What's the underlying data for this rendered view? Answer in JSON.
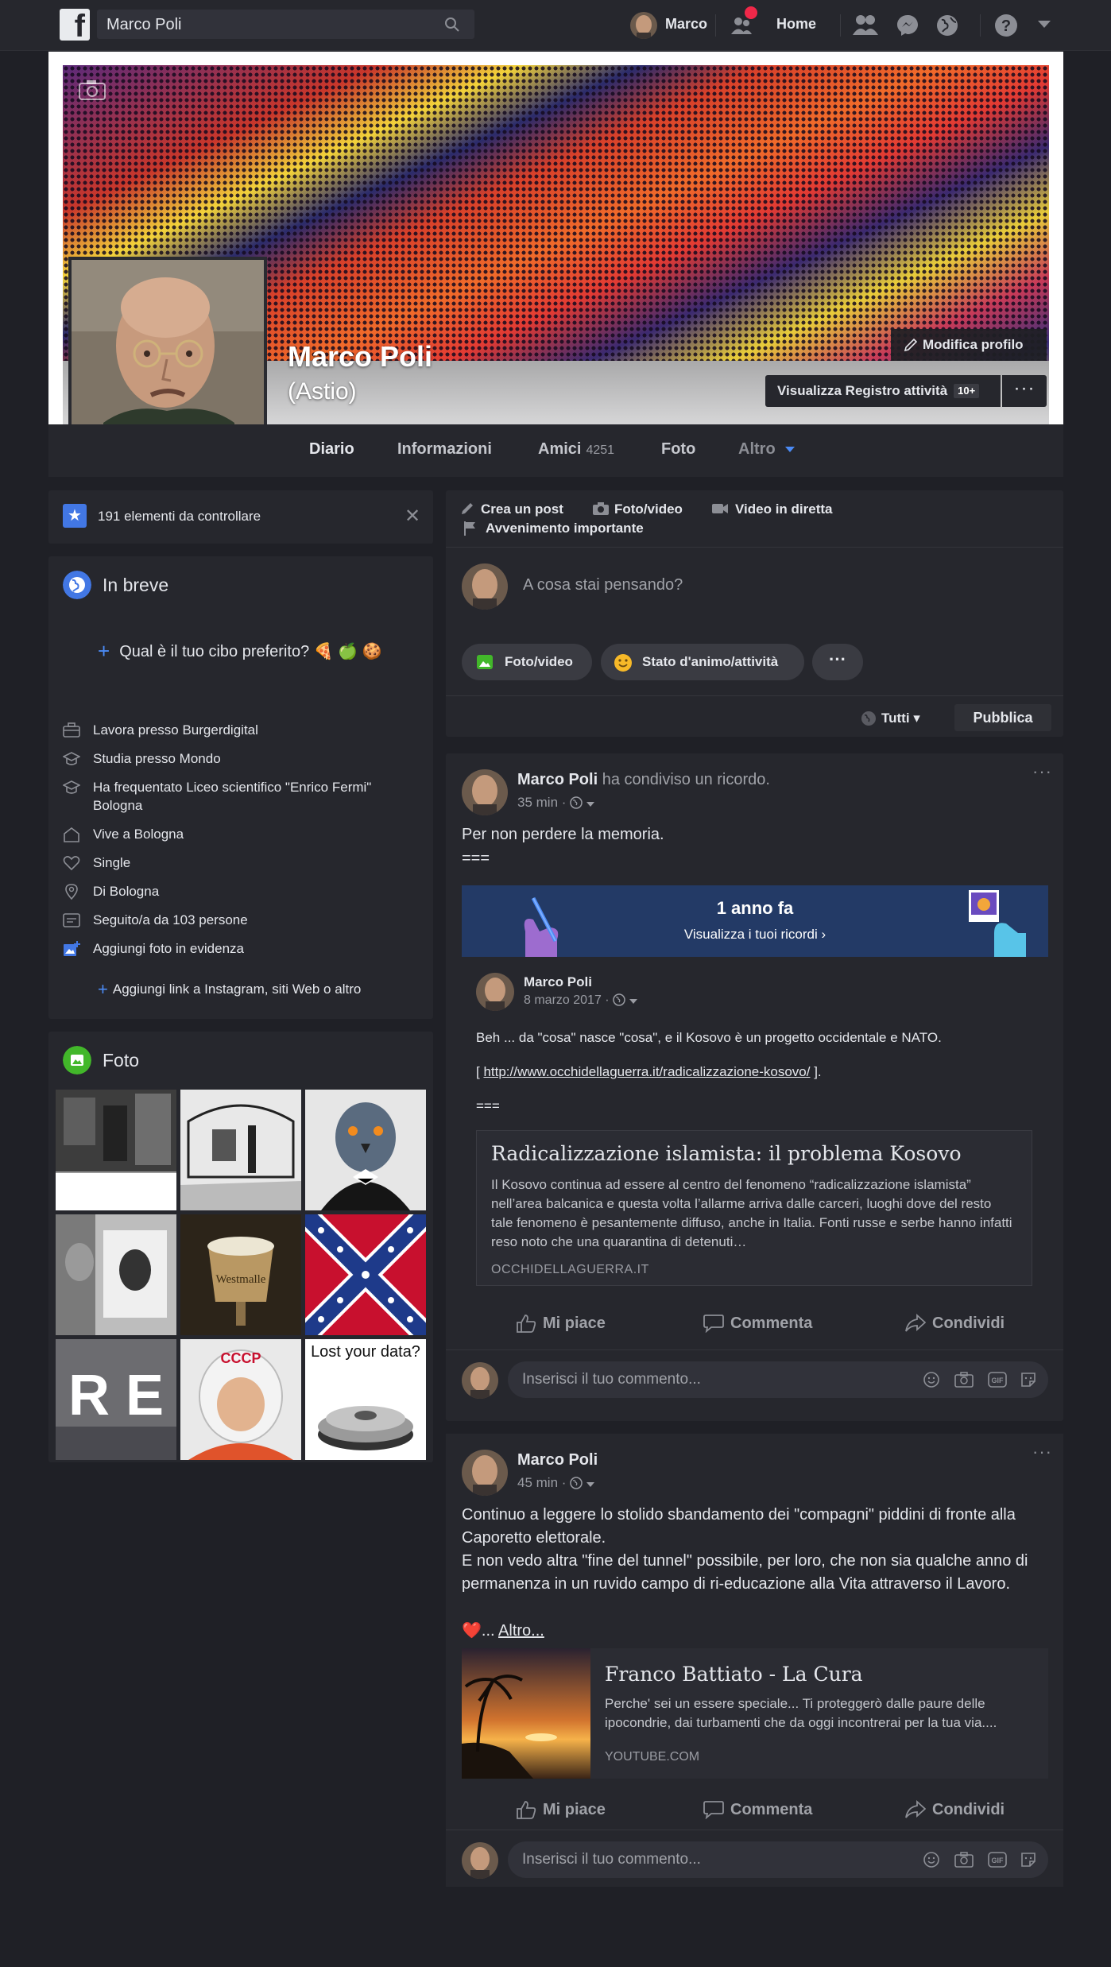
{
  "topbar": {
    "logo": "f",
    "search_value": "Marco Poli",
    "user_name": "Marco",
    "home_label": "Home"
  },
  "profile": {
    "name": "Marco Poli",
    "alt_name": "(Astio)",
    "edit_label": "Modifica profilo",
    "activity_log_label": "Visualizza Registro attività",
    "activity_badge": "10+",
    "more_label": "···"
  },
  "tabs": [
    {
      "label": "Diario"
    },
    {
      "label": "Informazioni"
    },
    {
      "label": "Amici",
      "count": "4251"
    },
    {
      "label": "Foto"
    },
    {
      "label": "Altro"
    }
  ],
  "review": {
    "text": "191 elementi da controllare",
    "close": "✕"
  },
  "intro": {
    "title": "In breve",
    "fav_food": "Qual è il tuo cibo preferito? 🍕 🍏 🍪",
    "items": [
      "Lavora presso Burgerdigital",
      "Studia presso Mondo",
      "Ha frequentato Liceo scientifico \"Enrico Fermi\" Bologna",
      "Vive a Bologna",
      "Single",
      "Di Bologna",
      "Seguito/a da 103 persone",
      "Aggiungi foto in evidenza"
    ],
    "add_link": "Aggiungi link a Instagram, siti Web o altro"
  },
  "photos": {
    "title": "Foto",
    "tile_text": [
      "R E",
      "Lost your data?",
      "CCCP",
      "Westmalle"
    ]
  },
  "composer": {
    "options": [
      "Crea un post",
      "Foto/video",
      "Video in diretta",
      "Avvenimento importante"
    ],
    "placeholder": "A cosa stai pensando?",
    "pills": [
      "Foto/video",
      "Stato d'animo/attività",
      "···"
    ],
    "audience": "Tutti",
    "publish": "Pubblica"
  },
  "post1": {
    "author": "Marco Poli",
    "action": "ha condiviso un ricordo.",
    "time": "35 min ·",
    "text_line1": "Per non perdere la memoria.",
    "text_line2": "===",
    "memory_title": "1 anno fa",
    "memory_sub": "Visualizza i tuoi ricordi ›",
    "inner_author": "Marco Poli",
    "inner_time": "8 marzo 2017 ·",
    "inner_text1": "Beh ... da \"cosa\" nasce \"cosa\", e il Kosovo è un progetto occidentale e NATO.",
    "inner_link_pre": "[ ",
    "inner_link": "http://www.occhidellaguerra.it/radicalizzazione-kosovo/",
    "inner_link_post": " ].",
    "inner_text3": "===",
    "card_title": "Radicalizzazione islamista: il problema Kosovo",
    "card_desc": "Il Kosovo continua ad essere al centro del fenomeno “radicalizzazione islamista” nell’area balcanica e questa volta l’allarme arriva dalle carceri, luoghi dove del resto tale fenomeno è pesantemente diffuso, anche in Italia. Fonti russe e serbe hanno infatti reso noto che una quarantina di detenuti…",
    "card_source": "OCCHIDELLAGUERRA.IT"
  },
  "post2": {
    "author": "Marco Poli",
    "time": "45 min ·",
    "text": "Continuo a leggere lo stolido sbandamento dei \"compagni\" piddini di fronte alla Caporetto elettorale.",
    "text2": "E non vedo altra \"fine del tunnel\" possibile, per loro, che non sia qualche anno di permanenza in un ruvido campo di ri-educazione alla Vita attraverso il Lavoro.",
    "heart": "❤️",
    "more_pre": "... ",
    "more": "Altro...",
    "card_title": "Franco Battiato - La Cura",
    "card_desc": "Perche' sei un essere speciale... Ti proteggerò dalle paure delle ipocondrie, dai turbamenti che da oggi incontrerai per la tua via....",
    "card_source": "YOUTUBE.COM"
  },
  "actions": {
    "like": "Mi piace",
    "comment": "Commenta",
    "share": "Condividi"
  },
  "comment": {
    "placeholder": "Inserisci il tuo commento...",
    "gif": "GIF"
  },
  "colors": {
    "background": "#1f2026",
    "card": "#26272d",
    "accent": "#4b8bf5",
    "memory_banner": "#233a66",
    "notification": "#f02849"
  }
}
